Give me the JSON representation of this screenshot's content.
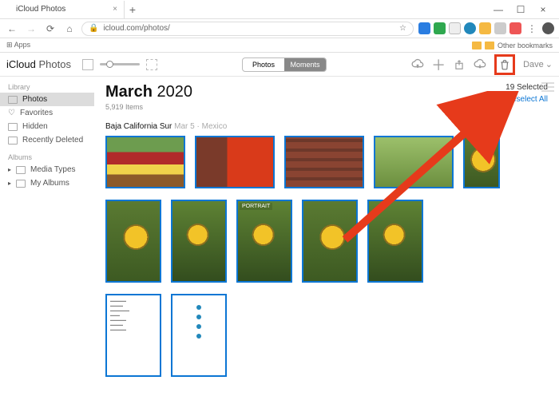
{
  "browser": {
    "tab_title": "iCloud Photos",
    "url": "icloud.com/photos/",
    "apps_label": "Apps",
    "other_bookmarks": "Other bookmarks"
  },
  "app": {
    "brand_a": "iCloud",
    "brand_b": "Photos",
    "segments": {
      "photos": "Photos",
      "moments": "Moments"
    },
    "user": "Dave"
  },
  "sidebar": {
    "groups": [
      {
        "heading": "Library",
        "items": [
          "Photos",
          "Favorites",
          "Hidden",
          "Recently Deleted"
        ]
      },
      {
        "heading": "Albums",
        "items": [
          "Media Types",
          "My Albums"
        ]
      }
    ]
  },
  "main": {
    "month": "March",
    "year": "2020",
    "count": "5,919 Items",
    "selected": "19 Selected",
    "deselect": "Deselect All",
    "location_main": "Baja California Sur",
    "location_date": "Mar 5",
    "location_country": "Mexico",
    "portrait_badge": "PORTRAIT"
  }
}
